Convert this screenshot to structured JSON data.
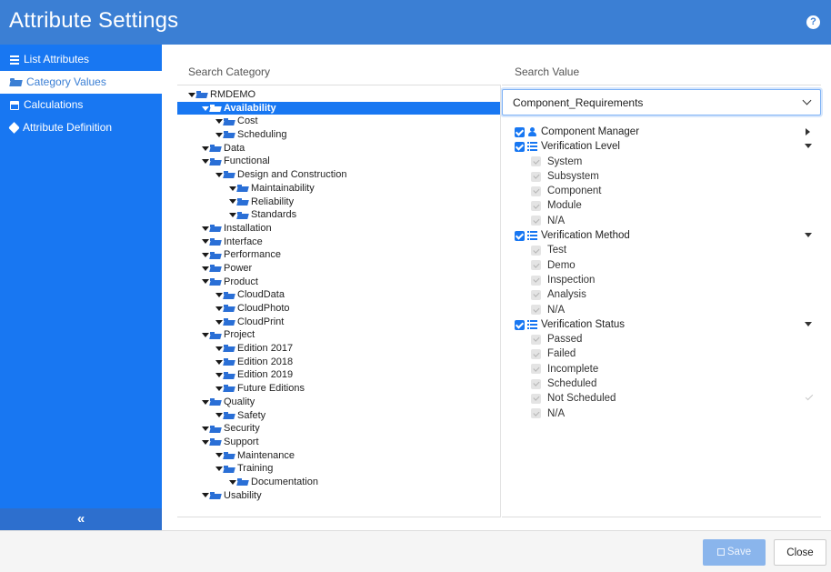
{
  "window": {
    "title": "Attribute Settings",
    "help_label": "?"
  },
  "sidebar": {
    "items": [
      {
        "label": "List Attributes",
        "icon": "list-icon",
        "active": false
      },
      {
        "label": "Category Values",
        "icon": "folder-open-icon",
        "active": true
      },
      {
        "label": "Calculations",
        "icon": "calculator-icon",
        "active": false
      },
      {
        "label": "Attribute Definition",
        "icon": "tag-icon",
        "active": false
      }
    ],
    "collapse_label": "«"
  },
  "category": {
    "header": "Search Category",
    "tree": [
      {
        "label": "RMDEMO",
        "depth": 0
      },
      {
        "label": "Availability",
        "depth": 1,
        "selected": true
      },
      {
        "label": "Cost",
        "depth": 2
      },
      {
        "label": "Scheduling",
        "depth": 2
      },
      {
        "label": "Data",
        "depth": 1
      },
      {
        "label": "Functional",
        "depth": 1
      },
      {
        "label": "Design and Construction",
        "depth": 2
      },
      {
        "label": "Maintainability",
        "depth": 3
      },
      {
        "label": "Reliability",
        "depth": 3
      },
      {
        "label": "Standards",
        "depth": 3
      },
      {
        "label": "Installation",
        "depth": 1
      },
      {
        "label": "Interface",
        "depth": 1
      },
      {
        "label": "Performance",
        "depth": 1
      },
      {
        "label": "Power",
        "depth": 1
      },
      {
        "label": "Product",
        "depth": 1
      },
      {
        "label": "CloudData",
        "depth": 2
      },
      {
        "label": "CloudPhoto",
        "depth": 2
      },
      {
        "label": "CloudPrint",
        "depth": 2
      },
      {
        "label": "Project",
        "depth": 1
      },
      {
        "label": "Edition 2017",
        "depth": 2
      },
      {
        "label": "Edition 2018",
        "depth": 2
      },
      {
        "label": "Edition 2019",
        "depth": 2
      },
      {
        "label": "Future Editions",
        "depth": 2
      },
      {
        "label": "Quality",
        "depth": 1
      },
      {
        "label": "Safety",
        "depth": 2
      },
      {
        "label": "Security",
        "depth": 1
      },
      {
        "label": "Support",
        "depth": 1
      },
      {
        "label": "Maintenance",
        "depth": 2
      },
      {
        "label": "Training",
        "depth": 2
      },
      {
        "label": "Documentation",
        "depth": 3
      },
      {
        "label": "Usability",
        "depth": 1
      }
    ]
  },
  "value": {
    "header": "Search Value",
    "selected_option": "Component_Requirements",
    "attributes": [
      {
        "label": "Component Manager",
        "icon": "user-icon",
        "checked": true,
        "control": "expand-right",
        "values": []
      },
      {
        "label": "Verification Level",
        "icon": "list-icon",
        "checked": true,
        "control": "collapse-down",
        "values": [
          "System",
          "Subsystem",
          "Component",
          "Module",
          "N/A"
        ]
      },
      {
        "label": "Verification Method",
        "icon": "list-icon",
        "checked": true,
        "control": "collapse-down",
        "values": [
          "Test",
          "Demo",
          "Inspection",
          "Analysis",
          "N/A"
        ]
      },
      {
        "label": "Verification Status",
        "icon": "list-icon",
        "checked": true,
        "control": "collapse-down",
        "values": [
          "Passed",
          "Failed",
          "Incomplete",
          "Scheduled",
          "Not Scheduled",
          "N/A"
        ]
      }
    ]
  },
  "footer": {
    "save_label": "Save",
    "close_label": "Close"
  }
}
